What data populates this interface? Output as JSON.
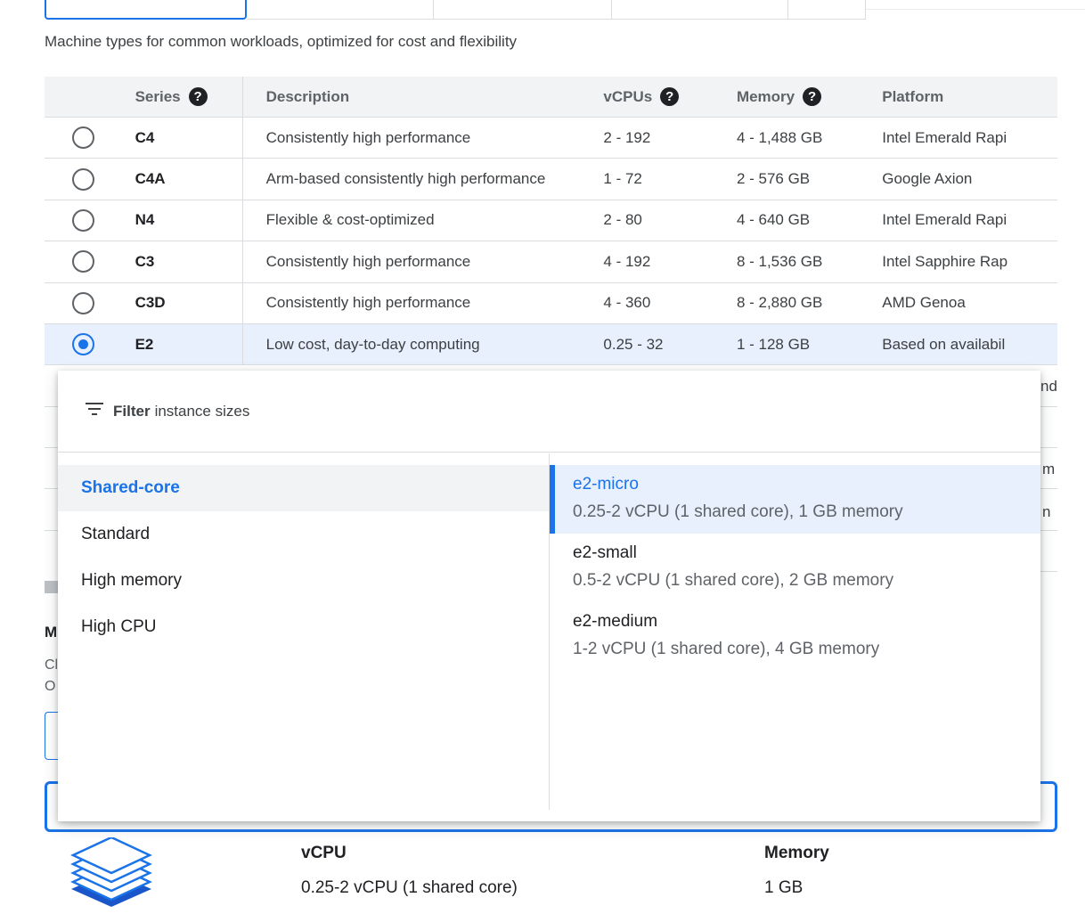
{
  "subtitle": "Machine types for common workloads, optimized for cost and flexibility",
  "table": {
    "headers": {
      "series": "Series",
      "description": "Description",
      "vcpus": "vCPUs",
      "memory": "Memory",
      "platform": "Platform"
    },
    "help_glyph": "?",
    "rows": [
      {
        "series": "C4",
        "description": "Consistently high performance",
        "vcpus": "2 - 192",
        "memory": "4 - 1,488 GB",
        "platform": "Intel Emerald Rapi",
        "selected": false
      },
      {
        "series": "C4A",
        "description": "Arm-based consistently high performance",
        "vcpus": "1 - 72",
        "memory": "2 - 576 GB",
        "platform": "Google Axion",
        "selected": false
      },
      {
        "series": "N4",
        "description": "Flexible & cost-optimized",
        "vcpus": "2 - 80",
        "memory": "4 - 640 GB",
        "platform": "Intel Emerald Rapi",
        "selected": false
      },
      {
        "series": "C3",
        "description": "Consistently high performance",
        "vcpus": "4 - 192",
        "memory": "8 - 1,536 GB",
        "platform": "Intel Sapphire Rap",
        "selected": false
      },
      {
        "series": "C3D",
        "description": "Consistently high performance",
        "vcpus": "4 - 360",
        "memory": "8 - 2,880 GB",
        "platform": "AMD Genoa",
        "selected": false
      },
      {
        "series": "E2",
        "description": "Low cost, day-to-day computing",
        "vcpus": "0.25 - 32",
        "memory": "1 - 128 GB",
        "platform": "Based on availabil",
        "selected": true
      }
    ]
  },
  "fragments": {
    "f1": "nd",
    "f2": "m",
    "f3": "n",
    "f4": "M",
    "f5": "Cl",
    "f6": "O"
  },
  "popover": {
    "filter_bold": "Filter",
    "filter_rest": "instance sizes",
    "categories": [
      "Shared-core",
      "Standard",
      "High memory",
      "High CPU"
    ],
    "active_category": "Shared-core",
    "types": [
      {
        "name": "e2-micro",
        "desc": "0.25-2 vCPU (1 shared core), 1 GB memory",
        "active": true
      },
      {
        "name": "e2-small",
        "desc": "0.5-2 vCPU (1 shared core), 2 GB memory",
        "active": false
      },
      {
        "name": "e2-medium",
        "desc": "1-2 vCPU (1 shared core), 4 GB memory",
        "active": false
      }
    ]
  },
  "summary": {
    "vcpu_label": "vCPU",
    "vcpu_value": "0.25-2 vCPU (1 shared core)",
    "memory_label": "Memory",
    "memory_value": "1 GB"
  },
  "colors": {
    "accent": "#1a73e8",
    "selected_row": "#e8f0fe",
    "header_bg": "#f1f3f4"
  },
  "icons": {
    "filter": "filter-lines-icon",
    "machine": "layers-stack-icon",
    "help": "help-circle-icon"
  }
}
